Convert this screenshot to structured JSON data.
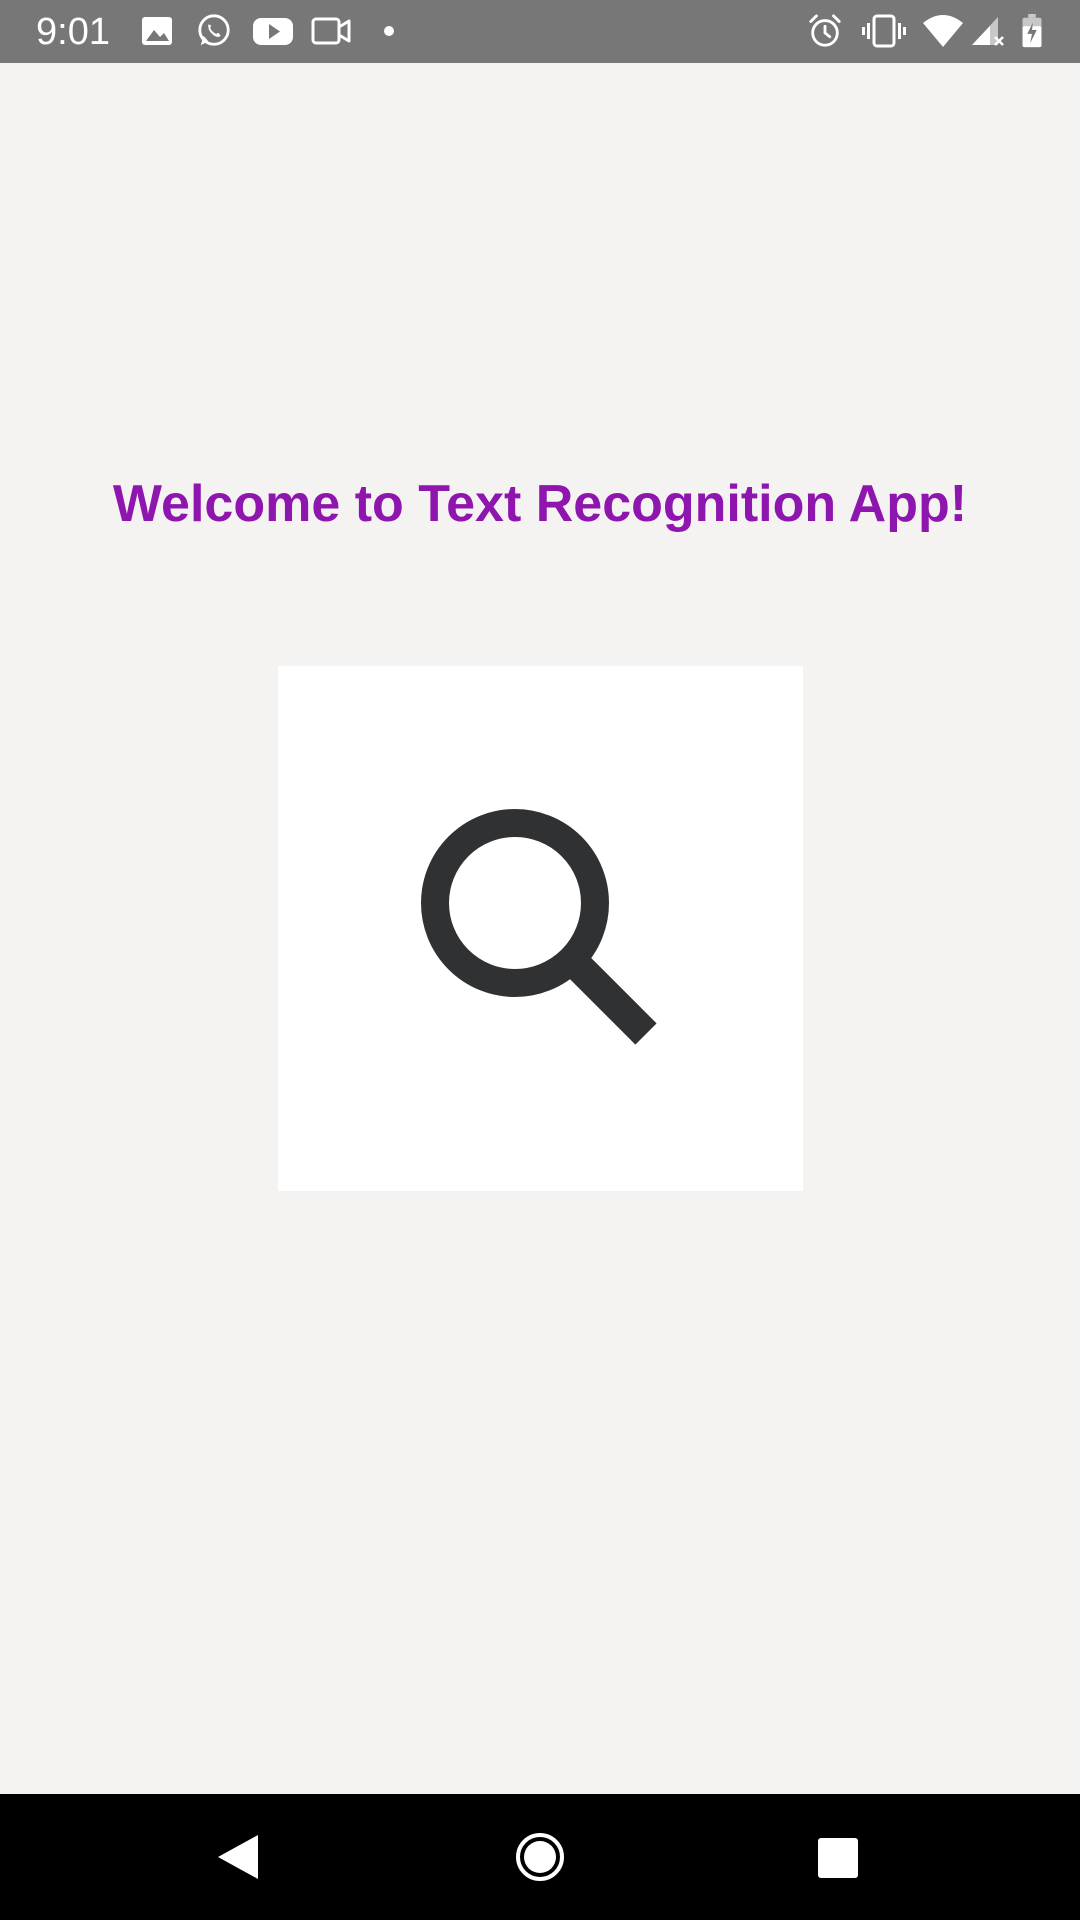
{
  "status_bar": {
    "time": "9:01",
    "left_icons": [
      "image-icon",
      "whatsapp-icon",
      "youtube-icon",
      "video-camera-icon",
      "notification-dot-icon"
    ],
    "right_icons": [
      "alarm-icon",
      "vibrate-icon",
      "wifi-icon",
      "cell-signal-icon",
      "battery-charging-icon"
    ]
  },
  "main": {
    "title": "Welcome to Text Recognition App!",
    "title_color": "#8e15ae",
    "action_icon": "search-icon"
  },
  "nav_bar": {
    "buttons": [
      "back-icon",
      "home-icon",
      "recents-icon"
    ]
  }
}
